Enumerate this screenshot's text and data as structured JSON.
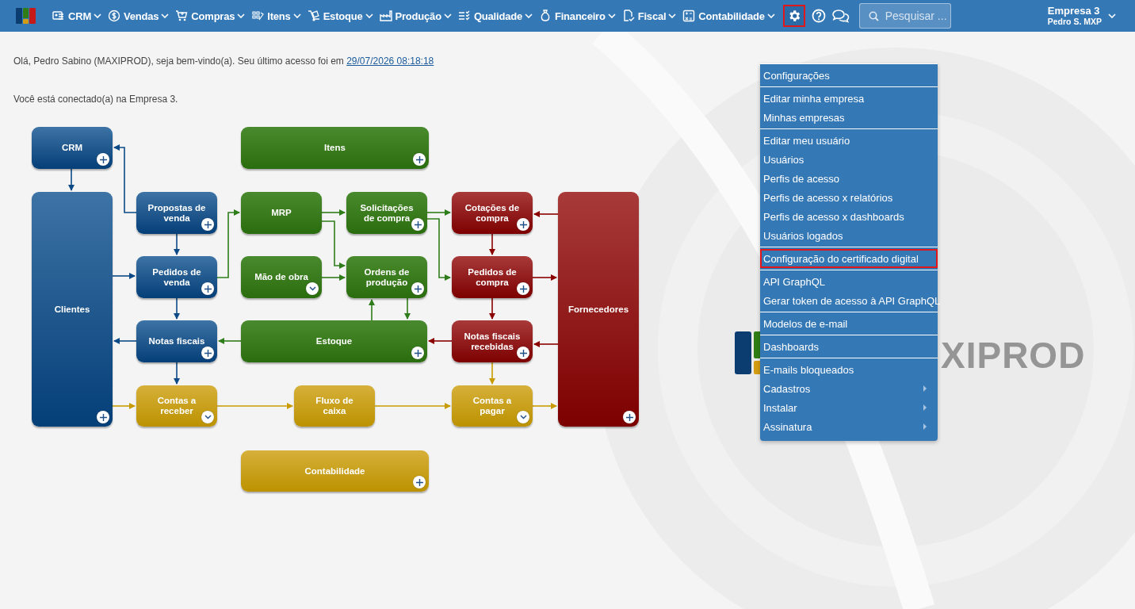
{
  "topbar": {
    "nav": [
      {
        "label": "CRM"
      },
      {
        "label": "Vendas"
      },
      {
        "label": "Compras"
      },
      {
        "label": "Itens"
      },
      {
        "label": "Estoque"
      },
      {
        "label": "Produção"
      },
      {
        "label": "Qualidade"
      },
      {
        "label": "Financeiro"
      },
      {
        "label": "Fiscal"
      },
      {
        "label": "Contabilidade"
      }
    ],
    "settings_button": {
      "highlighted": true,
      "expanded": true
    },
    "search": {
      "placeholder": "Pesquisar ..."
    },
    "company": {
      "name": "Empresa 3",
      "user": "Pedro S. MXP"
    }
  },
  "welcome": {
    "greeting": "Olá, Pedro Sabino (MAXIPROD), seja bem-vindo(a). Seu último acesso foi em ",
    "last_access": "29/07/2026 08:18:18",
    "connection": "Você está conectado(a) na Empresa 3."
  },
  "background_logo": {
    "text": "XIPROD"
  },
  "diagram": {
    "nodes": [
      {
        "label": "CRM",
        "color": "#0b4a86",
        "kind": "add"
      },
      {
        "label": "Itens",
        "color": "#2e7d1a",
        "kind": "add"
      },
      {
        "label": "Clientes",
        "color": "#0b4a86",
        "kind": "add"
      },
      {
        "label": "Propostas de venda",
        "color": "#0b4a86",
        "kind": "add"
      },
      {
        "label": "MRP",
        "color": "#2e7d1a",
        "kind": "plain"
      },
      {
        "label": "Solicitações de compra",
        "color": "#2e7d1a",
        "kind": "add"
      },
      {
        "label": "Cotações de compra",
        "color": "#8b0000",
        "kind": "add"
      },
      {
        "label": "Fornecedores",
        "color": "#8b0000",
        "kind": "add"
      },
      {
        "label": "Pedidos de venda",
        "color": "#0b4a86",
        "kind": "add"
      },
      {
        "label": "Mão de obra",
        "color": "#2e7d1a",
        "kind": "expand"
      },
      {
        "label": "Ordens de produção",
        "color": "#2e7d1a",
        "kind": "add"
      },
      {
        "label": "Pedidos de compra",
        "color": "#8b0000",
        "kind": "add"
      },
      {
        "label": "Notas fiscais",
        "color": "#0b4a86",
        "kind": "add"
      },
      {
        "label": "Estoque",
        "color": "#2e7d1a",
        "kind": "add"
      },
      {
        "label": "Notas fiscais recebidas",
        "color": "#8b0000",
        "kind": "add"
      },
      {
        "label": "Contas a receber",
        "color": "#c89b00",
        "kind": "expand"
      },
      {
        "label": "Fluxo de caixa",
        "color": "#c89b00",
        "kind": "plain"
      },
      {
        "label": "Contas a pagar",
        "color": "#c89b00",
        "kind": "expand"
      },
      {
        "label": "Contabilidade",
        "color": "#c89b00",
        "kind": "add"
      }
    ]
  },
  "settings_menu": {
    "groups": [
      [
        {
          "label": "Configurações",
          "kind": "item",
          "highlighted": false
        }
      ],
      [
        {
          "label": "Editar minha empresa",
          "kind": "item",
          "highlighted": false
        },
        {
          "label": "Minhas empresas",
          "kind": "item",
          "highlighted": false
        }
      ],
      [
        {
          "label": "Editar meu usuário",
          "kind": "item",
          "highlighted": false
        },
        {
          "label": "Usuários",
          "kind": "item",
          "highlighted": false
        },
        {
          "label": "Perfis de acesso",
          "kind": "item",
          "highlighted": false
        },
        {
          "label": "Perfis de acesso x relatórios",
          "kind": "item",
          "highlighted": false
        },
        {
          "label": "Perfis de acesso x dashboards",
          "kind": "item",
          "highlighted": false
        },
        {
          "label": "Usuários logados",
          "kind": "item",
          "highlighted": false
        }
      ],
      [
        {
          "label": "Configuração do certificado digital",
          "kind": "item",
          "highlighted": true
        }
      ],
      [
        {
          "label": "API GraphQL",
          "kind": "item",
          "highlighted": false
        },
        {
          "label": "Gerar token de acesso à API GraphQL",
          "kind": "item",
          "highlighted": false
        }
      ],
      [
        {
          "label": "Modelos de e-mail",
          "kind": "item",
          "highlighted": false
        }
      ],
      [
        {
          "label": "Dashboards",
          "kind": "item",
          "highlighted": false
        }
      ],
      [
        {
          "label": "E-mails bloqueados",
          "kind": "item",
          "highlighted": false
        },
        {
          "label": "Cadastros",
          "kind": "submenu",
          "highlighted": false
        },
        {
          "label": "Instalar",
          "kind": "submenu",
          "highlighted": false
        },
        {
          "label": "Assinatura",
          "kind": "submenu",
          "highlighted": false
        }
      ]
    ]
  }
}
